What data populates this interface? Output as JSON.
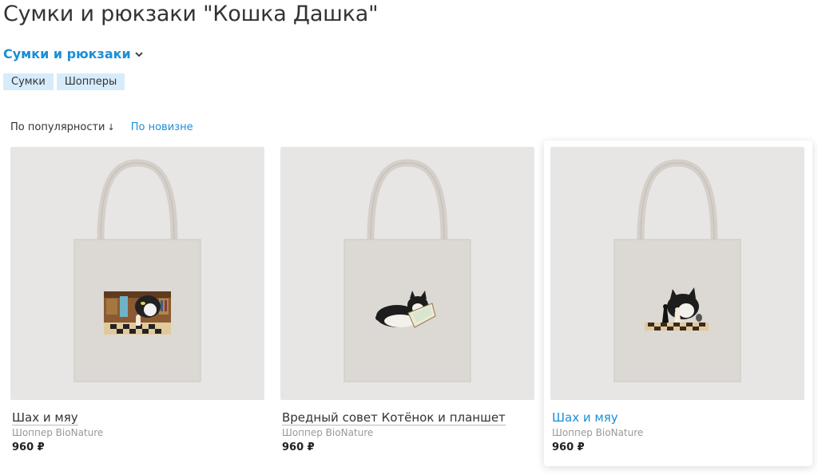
{
  "page": {
    "title": "Сумки и рюкзаки \"Кошка Дашка\""
  },
  "category": {
    "label": "Сумки и рюкзаки",
    "icon": "chevron-down-icon"
  },
  "tags": [
    "Сумки",
    "Шопперы"
  ],
  "sort": {
    "active": "По популярности",
    "active_arrow": "↓",
    "alternative": "По новизне"
  },
  "products": [
    {
      "name": "Шах и мяу",
      "subtitle": "Шоппер BioNature",
      "price": "960 ₽",
      "print": "cat-chess-library"
    },
    {
      "name": "Вредный совет Котёнок и планшет",
      "subtitle": "Шоппер BioNature",
      "price": "960 ₽",
      "print": "kitten-tablet"
    },
    {
      "name": "Шах и мяу",
      "subtitle": "Шоппер BioNature",
      "price": "960 ₽",
      "print": "cat-chess"
    }
  ],
  "colors": {
    "accent": "#1a8fd8",
    "tag_bg": "#d6ecfb",
    "bag": "#dcd8d3",
    "image_bg": "#e7e6e5"
  }
}
